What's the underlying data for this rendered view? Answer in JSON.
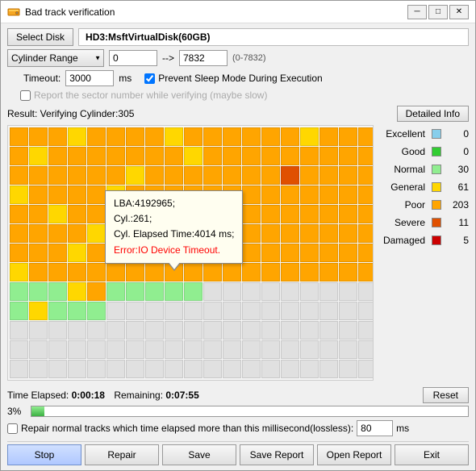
{
  "window": {
    "title": "Bad track verification",
    "icon": "hdd-icon"
  },
  "toolbar": {
    "select_disk_label": "Select Disk",
    "disk_name": "HD3:MsftVirtualDisk(60GB)"
  },
  "range": {
    "type": "Cylinder Range",
    "from": "0",
    "to": "7832",
    "range_info": "(0-7832)",
    "arrow": "-->"
  },
  "timeout": {
    "label": "Timeout:",
    "value": "3000",
    "unit": "ms"
  },
  "options": {
    "prevent_sleep": true,
    "prevent_sleep_label": "Prevent Sleep Mode During Execution",
    "report_sector": false,
    "report_sector_label": "Report the sector number while verifying (maybe slow)"
  },
  "result": {
    "label": "Result: Verifying Cylinder:305",
    "detailed_btn": "Detailed Info"
  },
  "tooltip": {
    "lba": "LBA:4192965;",
    "cyl": "Cyl.:261;",
    "elapsed": "Cyl. Elapsed Time:4014 ms;",
    "error": "Error:IO Device Timeout."
  },
  "legend": {
    "items": [
      {
        "label": "Excellent",
        "color": "#87ceeb",
        "count": "0"
      },
      {
        "label": "Good",
        "color": "#32cd32",
        "count": "0"
      },
      {
        "label": "Normal",
        "color": "#90ee90",
        "count": "30"
      },
      {
        "label": "General",
        "color": "#ffd700",
        "count": "61"
      },
      {
        "label": "Poor",
        "color": "#ffa500",
        "count": "203"
      },
      {
        "label": "Severe",
        "color": "#e05000",
        "count": "11"
      },
      {
        "label": "Damaged",
        "color": "#cc0000",
        "count": "5"
      }
    ]
  },
  "time": {
    "elapsed_label": "Time Elapsed:",
    "elapsed_value": "0:00:18",
    "remaining_label": "Remaining:",
    "remaining_value": "0:07:55",
    "reset_label": "Reset"
  },
  "progress": {
    "percent": "3%",
    "fill_width": "3"
  },
  "repair": {
    "checkbox": false,
    "label": "Repair normal tracks which time elapsed more than this millisecond(lossless):",
    "value": "80",
    "unit": "ms"
  },
  "buttons": {
    "stop": "Stop",
    "repair": "Repair",
    "save": "Save",
    "save_report": "Save Report",
    "open_report": "Open Report",
    "exit": "Exit"
  }
}
